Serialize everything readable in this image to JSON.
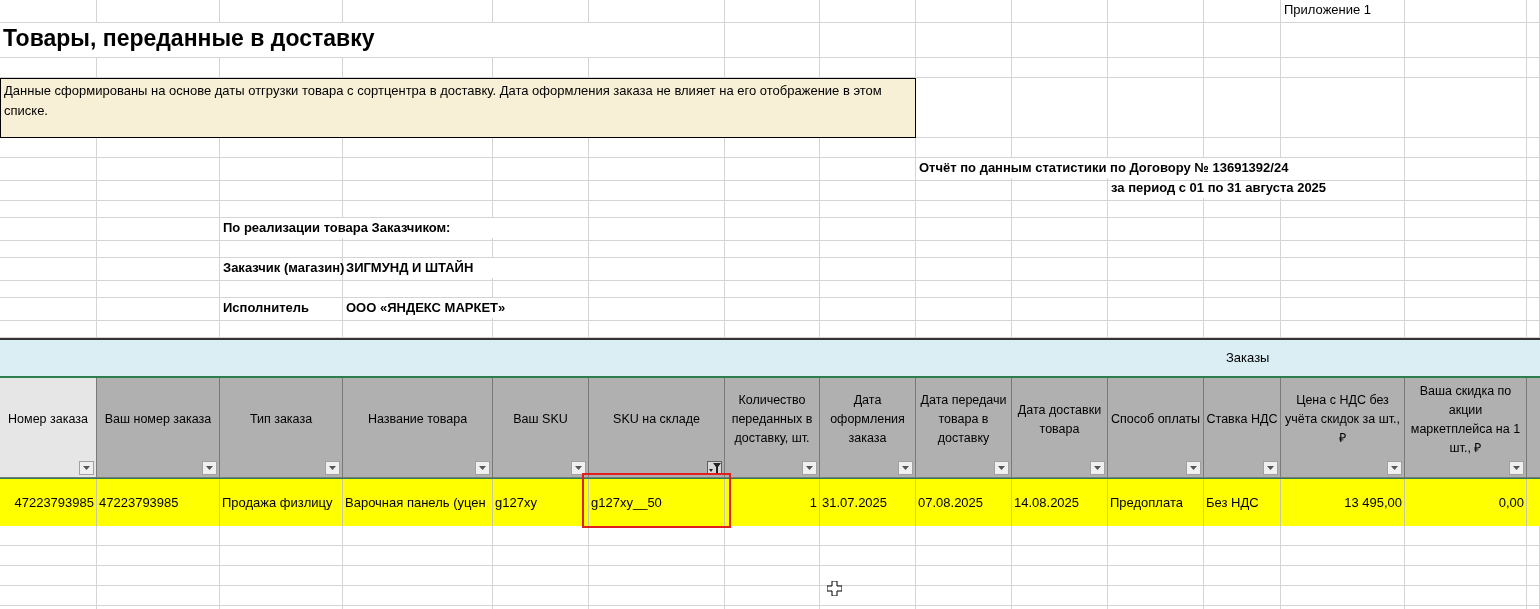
{
  "sheet": {
    "appendix": "Приложение 1",
    "title": "Товары, переданные в доставку",
    "note": "Данные сформированы на основе даты отгрузки товара с сортцентра в доставку. Дата оформления заказа не влияет на его отображение в этом списке.",
    "report_title": "Отчёт по данным статистики по Договору № 13691392/24",
    "period": "за период с 01 по 31 августа 2025",
    "sales_heading": "По реализации товара Заказчиком:",
    "customer_label": "Заказчик (магазин)",
    "customer": "ЗИГМУНД И ШТАЙН",
    "executor_label": "Исполнитель",
    "executor": "ООО «ЯНДЕКС МАРКЕТ»",
    "group_header": "Заказы",
    "columns": [
      {
        "label": "Номер заказа",
        "highlighted": true,
        "filter_active": false
      },
      {
        "label": "Ваш номер заказа",
        "highlighted": false,
        "filter_active": false
      },
      {
        "label": "Тип заказа",
        "highlighted": false,
        "filter_active": false
      },
      {
        "label": "Название товара",
        "highlighted": false,
        "filter_active": false
      },
      {
        "label": "Ваш SKU",
        "highlighted": false,
        "filter_active": false
      },
      {
        "label": "SKU на складе",
        "highlighted": false,
        "filter_active": true
      },
      {
        "label": "Количество переданных в доставку, шт.",
        "highlighted": false,
        "filter_active": false
      },
      {
        "label": "Дата оформления заказа",
        "highlighted": false,
        "filter_active": false
      },
      {
        "label": "Дата передачи товара в доставку",
        "highlighted": false,
        "filter_active": false
      },
      {
        "label": "Дата доставки товара",
        "highlighted": false,
        "filter_active": false
      },
      {
        "label": "Способ оплаты",
        "highlighted": false,
        "filter_active": false
      },
      {
        "label": "Ставка НДС",
        "highlighted": false,
        "filter_active": false
      },
      {
        "label": "Цена с НДС без учёта скидок за шт., ₽",
        "highlighted": false,
        "filter_active": false
      },
      {
        "label": "Ваша скидка по акции маркетплейса на 1 шт., ₽",
        "highlighted": false,
        "filter_active": false
      }
    ],
    "rows": [
      {
        "cells": [
          {
            "text": "47223793985",
            "kind": "number"
          },
          {
            "text": "47223793985",
            "kind": "text"
          },
          {
            "text": "Продажа физлицу",
            "kind": "text"
          },
          {
            "text": "Варочная панель (уцен",
            "kind": "text"
          },
          {
            "text": "g127xy",
            "kind": "text"
          },
          {
            "text": "g127xy__50",
            "kind": "text"
          },
          {
            "text": "1",
            "kind": "number"
          },
          {
            "text": "31.07.2025",
            "kind": "text"
          },
          {
            "text": "07.08.2025",
            "kind": "text"
          },
          {
            "text": "14.08.2025",
            "kind": "text"
          },
          {
            "text": "Предоплата",
            "kind": "text"
          },
          {
            "text": "Без НДС",
            "kind": "text"
          },
          {
            "text": "13 495,00",
            "kind": "number"
          },
          {
            "text": "0,00",
            "kind": "number"
          }
        ]
      }
    ]
  }
}
